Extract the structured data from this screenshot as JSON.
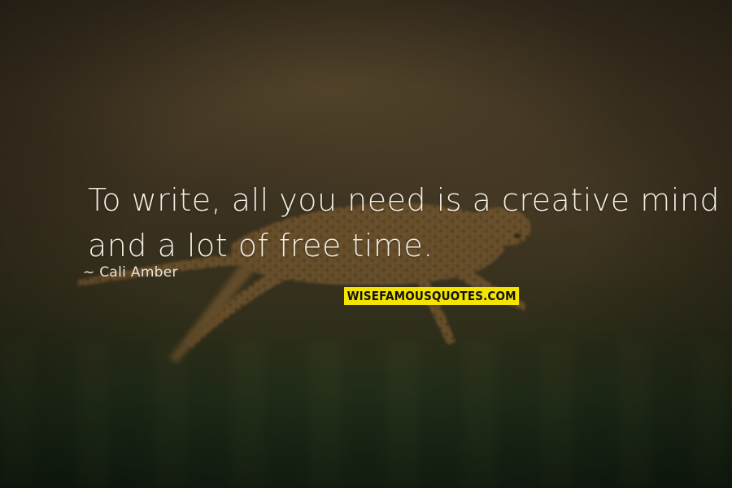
{
  "quote": {
    "lines": [
      "To write, all you need is a creative mind",
      "and a lot of free time."
    ]
  },
  "author": "~ Cali Amber",
  "watermark": "WISEFAMOUSQUOTES.COM",
  "background": {
    "subject": "running cheetah on grassland",
    "colors": {
      "sky": "#3a3020",
      "grass": "#1c2b18",
      "text": "#f3efe6",
      "watermark_bg": "#f5e400"
    }
  }
}
